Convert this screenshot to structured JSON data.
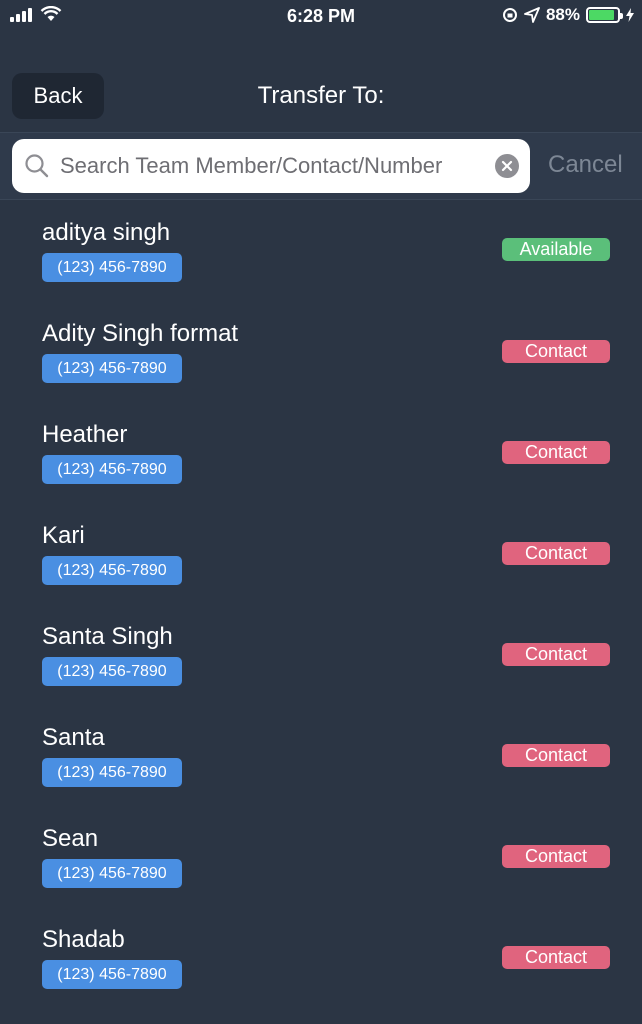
{
  "status_bar": {
    "time": "6:28 PM",
    "battery_text": "88%",
    "battery_level": 0.88,
    "battery_color": "#4cd964"
  },
  "nav": {
    "back_label": "Back",
    "title": "Transfer To:"
  },
  "search": {
    "placeholder": "Search Team Member/Contact/Number",
    "value": "",
    "cancel_label": "Cancel"
  },
  "colors": {
    "background": "#2b3544",
    "phone_badge": "#4a8fe2",
    "available": "#5bbf7a",
    "contact": "#e0647e"
  },
  "contacts": [
    {
      "name": "aditya singh",
      "phone": "(123) 456-7890",
      "status": "Available",
      "kind": "available"
    },
    {
      "name": "Adity Singh format",
      "phone": "(123) 456-7890",
      "status": "Contact",
      "kind": "contact"
    },
    {
      "name": "Heather",
      "phone": "(123) 456-7890",
      "status": "Contact",
      "kind": "contact"
    },
    {
      "name": "Kari",
      "phone": "(123) 456-7890",
      "status": "Contact",
      "kind": "contact"
    },
    {
      "name": "Santa Singh",
      "phone": "(123) 456-7890",
      "status": "Contact",
      "kind": "contact"
    },
    {
      "name": "Santa",
      "phone": "(123) 456-7890",
      "status": "Contact",
      "kind": "contact"
    },
    {
      "name": "Sean",
      "phone": "(123) 456-7890",
      "status": "Contact",
      "kind": "contact"
    },
    {
      "name": "Shadab",
      "phone": "(123) 456-7890",
      "status": "Contact",
      "kind": "contact"
    }
  ]
}
